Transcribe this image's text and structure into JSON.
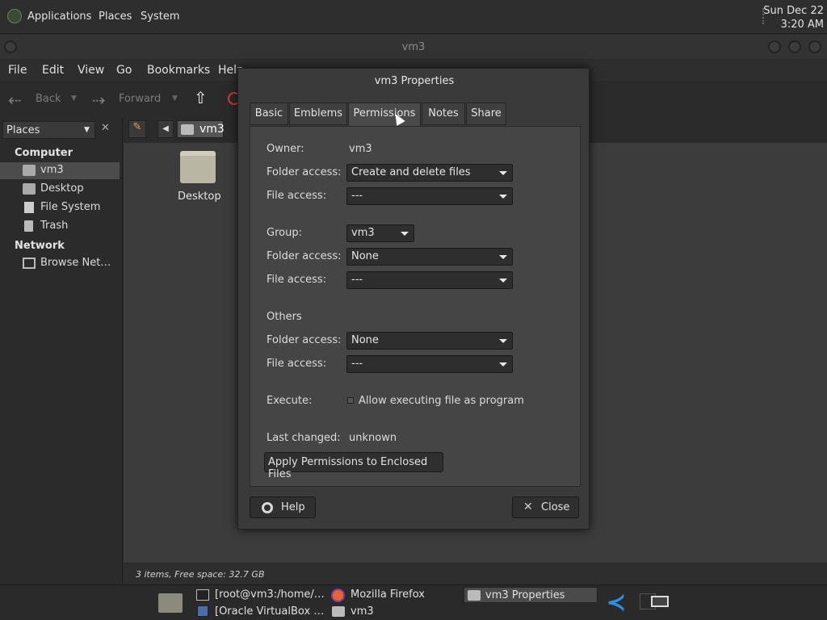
{
  "top_panel": {
    "menus": [
      "Applications",
      "Places",
      "System"
    ],
    "clock_date": "Sun Dec 22",
    "clock_time": "3:20 AM"
  },
  "window": {
    "title": "vm3"
  },
  "menubar": [
    "File",
    "Edit",
    "View",
    "Go",
    "Bookmarks",
    "Help"
  ],
  "toolbar": {
    "back": "Back",
    "forward": "Forward"
  },
  "sidebar": {
    "selector": "Places",
    "computer_heading": "Computer",
    "computer_items": [
      "vm3",
      "Desktop",
      "File System",
      "Trash"
    ],
    "network_heading": "Network",
    "network_items": [
      "Browse Net…"
    ]
  },
  "pathbar": {
    "crumb": "vm3"
  },
  "content": {
    "items": [
      {
        "name": "Desktop",
        "icon": "folder-icon"
      }
    ]
  },
  "statusbar": "3 items, Free space: 32.7 GB",
  "dialog": {
    "title": "vm3 Properties",
    "tabs": [
      "Basic",
      "Emblems",
      "Permissions",
      "Notes",
      "Share"
    ],
    "active_tab": "Permissions",
    "owner_label": "Owner:",
    "owner_value": "vm3",
    "folder_access_label": "Folder access:",
    "file_access_label": "File access:",
    "owner_folder_access": "Create and delete files",
    "owner_file_access": "---",
    "group_label": "Group:",
    "group_value": "vm3",
    "group_folder_access": "None",
    "group_file_access": "---",
    "others_label": "Others",
    "others_folder_access": "None",
    "others_file_access": "---",
    "execute_label": "Execute:",
    "execute_checkbox": "Allow executing file as program",
    "last_changed_label": "Last changed:",
    "last_changed_value": "unknown",
    "apply_button": "Apply Permissions to Enclosed Files",
    "help_button": "Help",
    "close_button": "Close"
  },
  "taskbar": {
    "tasks": [
      "[root@vm3:/home/…",
      "Mozilla Firefox",
      "vm3 Properties",
      "[Oracle VirtualBox …",
      "vm3"
    ]
  },
  "colors": {
    "panel": "#2e2e2e",
    "content_bg": "#3c3c3c",
    "dialog_bg": "#3a3a3a",
    "active_task": "#4a4a4a"
  }
}
